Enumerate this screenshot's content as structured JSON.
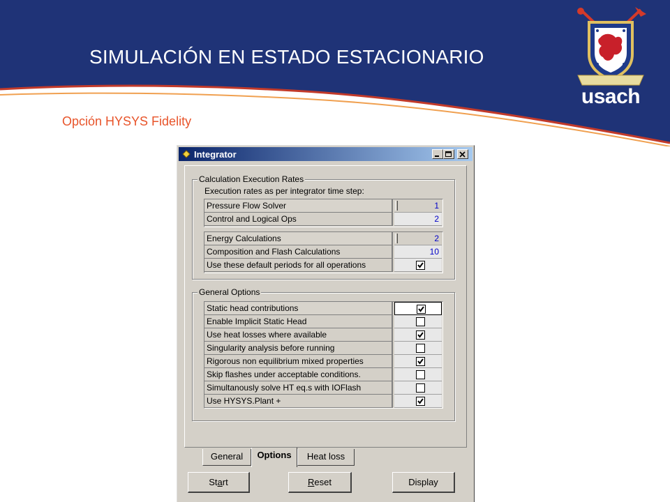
{
  "slide": {
    "title": "SIMULACIÓN EN ESTADO ESTACIONARIO",
    "subtitle": "Opción HYSYS Fidelity",
    "logo_text": "usach",
    "colors": {
      "header_blue": "#1f3377",
      "accent_red": "#e8542a",
      "accent_orange": "#f0a050"
    }
  },
  "window": {
    "title": "Integrator",
    "icon": "hysys-app-icon",
    "controls": [
      "minimize-icon",
      "maximize-icon",
      "close-icon"
    ]
  },
  "calc_group": {
    "label": "Calculation Execution Rates",
    "sub": "Execution rates as per integrator time step:",
    "rows_a": [
      {
        "label": "Pressure Flow Solver",
        "value": "1"
      },
      {
        "label": "Control and Logical Ops",
        "value": "2"
      }
    ],
    "rows_b": [
      {
        "label": "Energy Calculations",
        "value": "2"
      },
      {
        "label": "Composition and Flash Calculations",
        "value": "10"
      },
      {
        "label": "Use these default periods for all operations",
        "checked": true
      }
    ]
  },
  "general_group": {
    "label": "General Options",
    "rows": [
      {
        "label": "Static head contributions",
        "checked": true
      },
      {
        "label": "Enable Implicit Static Head",
        "checked": false
      },
      {
        "label": "Use heat losses where available",
        "checked": true
      },
      {
        "label": "Singularity analysis before running",
        "checked": false
      },
      {
        "label": "Rigorous non equilibrium mixed properties",
        "checked": true
      },
      {
        "label": "Skip flashes under acceptable conditions.",
        "checked": false
      },
      {
        "label": "Simultanously solve HT eq.s with IOFlash",
        "checked": false
      },
      {
        "label": "Use HYSYS.Plant +",
        "checked": true
      }
    ]
  },
  "tabs": [
    {
      "label": "General",
      "active": false
    },
    {
      "label": "Options",
      "active": true
    },
    {
      "label": "Heat loss",
      "active": false
    }
  ],
  "buttons": {
    "start_pre": "St",
    "start_u": "a",
    "start_post": "rt",
    "reset_pre": "",
    "reset_u": "R",
    "reset_post": "eset",
    "display": "Display"
  }
}
